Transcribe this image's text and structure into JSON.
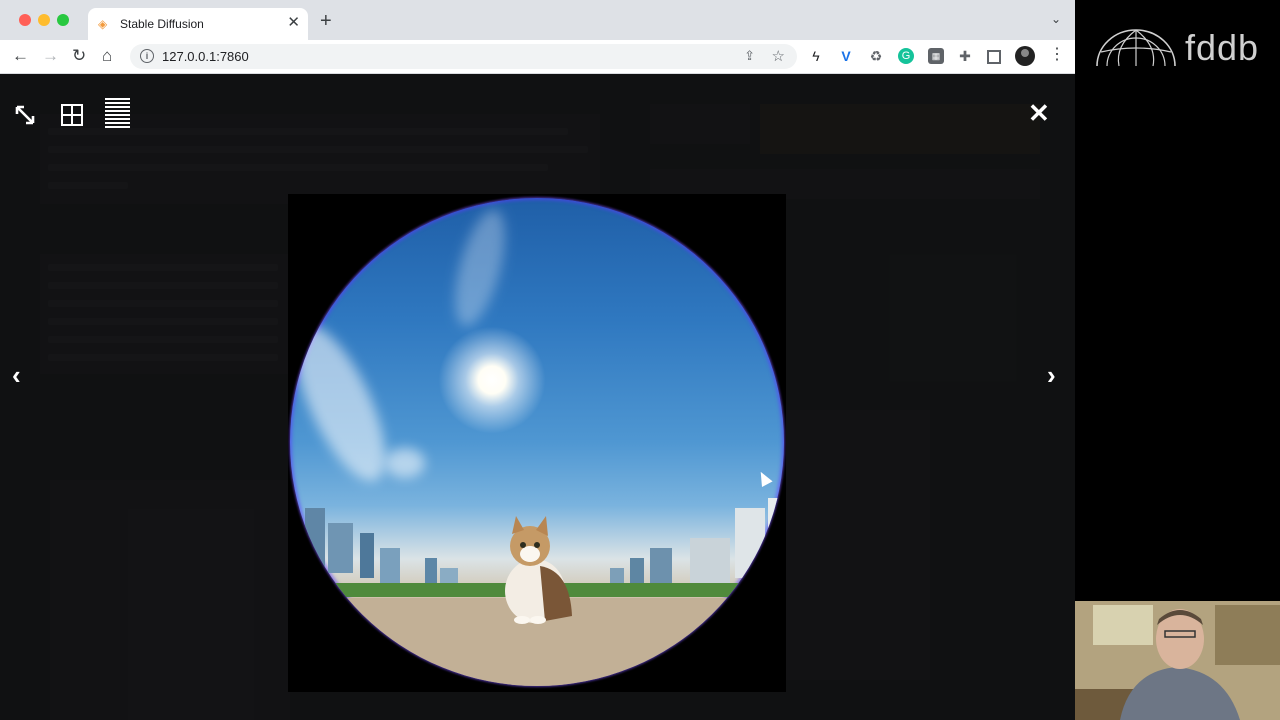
{
  "browser": {
    "tab": {
      "title": "Stable Diffusion",
      "close_glyph": "✕",
      "favicon": "stable-diffusion-favicon"
    },
    "new_tab_glyph": "+",
    "tab_dropdown_glyph": "⌄",
    "url": "127.0.0.1:7860",
    "nav": {
      "back": "←",
      "forward": "→",
      "reload": "↻",
      "home": "⌂"
    }
  },
  "lightbox": {
    "close_glyph": "✕",
    "prev_glyph": "‹",
    "next_glyph": "›",
    "image_subject": "fisheye cat city sun"
  },
  "logo": {
    "text": "fddb"
  },
  "colors": {
    "accent": "#15c39a",
    "overlay": "#121212",
    "sky": "#2f78c0"
  }
}
